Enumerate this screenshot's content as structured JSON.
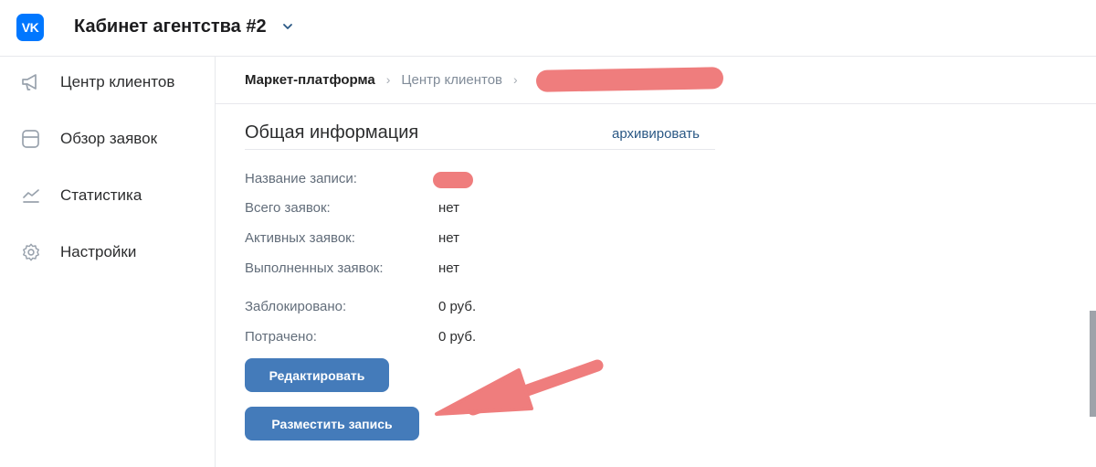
{
  "header": {
    "logo_text": "VK",
    "cabinet_title": "Кабинет агентства #2",
    "accent_color": "#0077ff"
  },
  "sidebar": {
    "items": [
      {
        "label": "Центр клиентов",
        "icon": "megaphone-icon"
      },
      {
        "label": "Обзор заявок",
        "icon": "inbox-icon"
      },
      {
        "label": "Статистика",
        "icon": "chart-icon"
      },
      {
        "label": "Настройки",
        "icon": "gear-icon"
      }
    ]
  },
  "breadcrumb": {
    "items": [
      "Маркет-платформа",
      "Центр клиентов"
    ],
    "separator": "›"
  },
  "section": {
    "title": "Общая информация",
    "archive_label": "архивировать"
  },
  "info": {
    "rows": [
      {
        "label": "Название записи:",
        "value": ""
      },
      {
        "label": "Всего заявок:",
        "value": "нет"
      },
      {
        "label": "Активных заявок:",
        "value": "нет"
      },
      {
        "label": "Выполненных заявок:",
        "value": "нет"
      },
      {
        "label": "Заблокировано:",
        "value": "0 руб."
      },
      {
        "label": "Потрачено:",
        "value": "0 руб."
      }
    ]
  },
  "buttons": {
    "edit_label": "Редактировать",
    "post_label": "Разместить запись",
    "button_color": "#447bba"
  },
  "annotation": {
    "color": "#ef7d7d"
  }
}
